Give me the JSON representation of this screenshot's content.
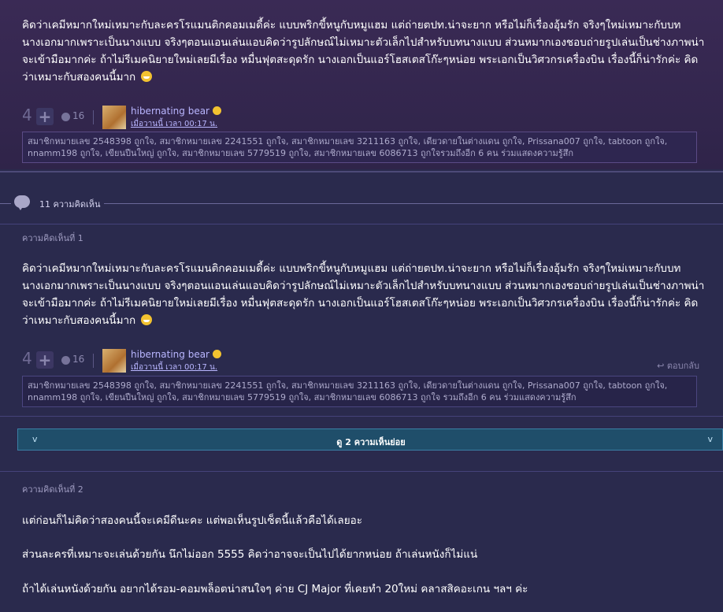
{
  "post": {
    "body": "คิดว่าเคมีหมากใหม่เหมาะกับละครโรแมนติกคอมเมดี้ค่ะ แบบพริกขี้หนูกับหมูแฮม แต่ถ่ายตปท.น่าจะยาก หรือไม่ก็เรื่องอุ้มรัก จริงๆใหม่เหมาะกับบทนางเอกมากเพราะเป็นนางแบบ จริงๆตอนแอนเล่นแอบคิดว่ารูปลักษณ์ไม่เหมาะตัวเล็กไปสำหรับบทนางแบบ ส่วนหมากเองชอบถ่ายรูปเล่นเป็นช่างภาพน่าจะเข้ามือมากค่ะ ถ้าไม่รีเมคนิยายใหม่เลยมีเรื่อง หมื่นฟุตสะดุดรัก นางเอกเป็นแอร์โฮสเตสโก๊ะๆหน่อย พระเอกเป็นวิศวกรเครื่องบิน เรื่องนี้ก็น่ารักค่ะ คิดว่าเหมาะกับสองคนนี้มาก",
    "votes": "4",
    "plus": "+",
    "emotions": "16",
    "username": "hibernating bear",
    "time": "เมื่อวานนี้ เวลา 00:17 น.",
    "likers": "สมาชิกหมายเลข 2548398 ถูกใจ, สมาชิกหมายเลข 2241551 ถูกใจ, สมาชิกหมายเลข 3211163 ถูกใจ, เดียวดายในต่างแดน ถูกใจ, Prissana007 ถูกใจ, tabtoon ถูกใจ, nnamm198 ถูกใจ, เขียนปืนใหญ่ ถูกใจ, สมาชิกหมายเลข 5779519 ถูกใจ, สมาชิกหมายเลข 6086713 ถูกใจรวมถึงอีก 6 คน ร่วมแสดงความรู้สึก"
  },
  "comments_header": {
    "count_label": "11 ความคิดเห็น"
  },
  "comment1": {
    "label": "ความคิดเห็นที่ 1",
    "body": "คิดว่าเคมีหมากใหม่เหมาะกับละครโรแมนติกคอมเมดี้ค่ะ แบบพริกขี้หนูกับหมูแฮม แต่ถ่ายตปท.น่าจะยาก หรือไม่ก็เรื่องอุ้มรัก จริงๆใหม่เหมาะกับบทนางเอกมากเพราะเป็นนางแบบ จริงๆตอนแอนเล่นแอบคิดว่ารูปลักษณ์ไม่เหมาะตัวเล็กไปสำหรับบทนางแบบ ส่วนหมากเองชอบถ่ายรูปเล่นเป็นช่างภาพน่าจะเข้ามือมากค่ะ ถ้าไม่รีเมคนิยายใหม่เลยมีเรื่อง หมื่นฟุตสะดุดรัก นางเอกเป็นแอร์โฮสเตสโก๊ะๆหน่อย พระเอกเป็นวิศวกรเครื่องบิน เรื่องนี้ก็น่ารักค่ะ คิดว่าเหมาะกับสองคนนี้มาก",
    "votes": "4",
    "plus": "+",
    "emotions": "16",
    "username": "hibernating bear",
    "time": "เมื่อวานนี้ เวลา 00:17 น.",
    "reply": "↩ ตอบกลับ",
    "likers": "สมาชิกหมายเลข 2548398 ถูกใจ, สมาชิกหมายเลข 2241551 ถูกใจ, สมาชิกหมายเลข 3211163 ถูกใจ, เดียวดายในต่างแดน ถูกใจ, Prissana007 ถูกใจ, tabtoon ถูกใจ, nnamm198 ถูกใจ, เขียนปืนใหญ่ ถูกใจ, สมาชิกหมายเลข 5779519 ถูกใจ, สมาชิกหมายเลข 6086713 ถูกใจ รวมถึงอีก 6 คน ร่วมแสดงความรู้สึก"
  },
  "subcomments": {
    "label": "ดู 2 ความเห็นย่อย",
    "chevron_left": "v",
    "chevron_right": "v"
  },
  "comment2": {
    "label": "ความคิดเห็นที่ 2",
    "line1": "แต่ก่อนก็ไม่คิดว่าสองคนนี้จะเคมีดีนะคะ แต่พอเห็นรูปเซ็ตนี้แล้วคือได้เลยอะ",
    "line2": "ส่วนละครที่เหมาะจะเล่นด้วยกัน นึกไม่ออก 5555 คิดว่าอาจจะเป็นไปได้ยากหน่อย ถ้าเล่นหนังก็ไม่แน่",
    "line3": "ถ้าได้เล่นหนังด้วยกัน อยากได้รอม-คอมพล็อตน่าสนใจๆ ค่าย CJ Major ที่เคยทำ 20ใหม่ คลาสสิคอะเกน ฯลฯ ค่ะ"
  }
}
